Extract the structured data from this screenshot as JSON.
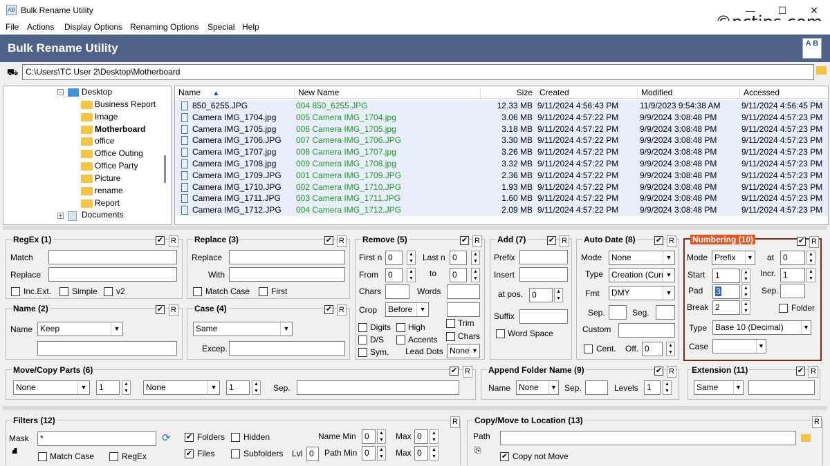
{
  "window": {
    "title": "Bulk Rename Utility",
    "minimize_glyph": "—",
    "maximize_glyph": "☐",
    "close_glyph": "✕"
  },
  "watermark": "©pctips.com",
  "menu": [
    "File",
    "Actions",
    "Display Options",
    "Renaming Options",
    "Special",
    "Help"
  ],
  "banner": {
    "title": "Bulk Rename Utility",
    "logo_text": "A B"
  },
  "path": "C:\\Users\\TC User 2\\Desktop\\Motherboard",
  "tree": {
    "items": [
      {
        "label": "Desktop",
        "bold": false,
        "icon": "desktop-icon"
      },
      {
        "label": "Business Report",
        "bold": false
      },
      {
        "label": "Image",
        "bold": false
      },
      {
        "label": "Motherboard",
        "bold": true
      },
      {
        "label": "office",
        "bold": false
      },
      {
        "label": "Office Outing",
        "bold": false
      },
      {
        "label": "Office Party",
        "bold": false
      },
      {
        "label": "Picture",
        "bold": false
      },
      {
        "label": "rename",
        "bold": false
      },
      {
        "label": "Report",
        "bold": false
      },
      {
        "label": "Documents",
        "bold": false,
        "icon": "documents-icon"
      }
    ]
  },
  "file_list": {
    "columns": [
      "Name",
      "New Name",
      "Size",
      "Created",
      "Modified",
      "Accessed"
    ],
    "sort_indicator": "▲",
    "rows": [
      {
        "name": "850_6255.JPG",
        "new": "004 850_6255.JPG",
        "size": "12.33 MB",
        "created": "9/11/2024 4:56:43 PM",
        "modified": "11/9/2023 9:54:38 AM",
        "accessed": "9/11/2024 4:56:45 PM"
      },
      {
        "name": "Camera IMG_1704.jpg",
        "new": "005 Camera IMG_1704.jpg",
        "size": "3.06 MB",
        "created": "9/11/2024 4:57:22 PM",
        "modified": "9/9/2024 3:08:48 PM",
        "accessed": "9/11/2024 4:57:23 PM"
      },
      {
        "name": "Camera IMG_1705.jpg",
        "new": "006 Camera IMG_1705.jpg",
        "size": "3.18 MB",
        "created": "9/11/2024 4:57:22 PM",
        "modified": "9/9/2024 3:08:48 PM",
        "accessed": "9/11/2024 4:57:23 PM"
      },
      {
        "name": "Camera IMG_1706.JPG",
        "new": "007 Camera IMG_1706.JPG",
        "size": "3.30 MB",
        "created": "9/11/2024 4:57:22 PM",
        "modified": "9/9/2024 3:08:48 PM",
        "accessed": "9/11/2024 4:57:23 PM"
      },
      {
        "name": "Camera IMG_1707.jpg",
        "new": "008 Camera IMG_1707.jpg",
        "size": "3.26 MB",
        "created": "9/11/2024 4:57:22 PM",
        "modified": "9/9/2024 3:08:48 PM",
        "accessed": "9/11/2024 4:57:23 PM"
      },
      {
        "name": "Camera IMG_1708.jpg",
        "new": "009 Camera IMG_1708.jpg",
        "size": "3.32 MB",
        "created": "9/11/2024 4:57:22 PM",
        "modified": "9/9/2024 3:08:48 PM",
        "accessed": "9/11/2024 4:57:23 PM"
      },
      {
        "name": "Camera IMG_1709.JPG",
        "new": "001 Camera IMG_1709.JPG",
        "size": "2.36 MB",
        "created": "9/11/2024 4:57:22 PM",
        "modified": "9/9/2024 3:08:48 PM",
        "accessed": "9/11/2024 4:57:23 PM"
      },
      {
        "name": "Camera IMG_1710.JPG",
        "new": "002 Camera IMG_1710.JPG",
        "size": "1.93 MB",
        "created": "9/11/2024 4:57:22 PM",
        "modified": "9/9/2024 3:08:48 PM",
        "accessed": "9/11/2024 4:57:23 PM"
      },
      {
        "name": "Camera IMG_1711.JPG",
        "new": "003 Camera IMG_1711.JPG",
        "size": "1.60 MB",
        "created": "9/11/2024 4:57:22 PM",
        "modified": "9/9/2024 3:08:48 PM",
        "accessed": "9/11/2024 4:57:23 PM"
      },
      {
        "name": "Camera IMG_1712.JPG",
        "new": "004 Camera IMG_1712.JPG",
        "size": "2.09 MB",
        "created": "9/11/2024 4:57:22 PM",
        "modified": "9/9/2024 3:08:48 PM",
        "accessed": "9/11/2024 4:57:23 PM"
      }
    ]
  },
  "checkmark": "✔",
  "regex": {
    "title": "RegEx (1)",
    "match": "Match",
    "replace": "Replace",
    "incext": "Inc.Ext.",
    "simple": "Simple",
    "v2": "v2",
    "r": "R"
  },
  "replace": {
    "title": "Replace (3)",
    "replace": "Replace",
    "with": "With",
    "match_case": "Match Case",
    "first": "First",
    "r": "R"
  },
  "remove": {
    "title": "Remove (5)",
    "first_n": "First n",
    "first_n_val": "0",
    "last_n": "Last n",
    "last_n_val": "0",
    "from": "From",
    "from_val": "0",
    "to": "to",
    "to_val": "0",
    "chars": "Chars",
    "words": "Words",
    "crop": "Crop",
    "crop_val": "Before",
    "digits": "Digits",
    "high": "High",
    "trim": "Trim",
    "ds": "D/S",
    "accents": "Accents",
    "chars2": "Chars",
    "sym": "Sym.",
    "lead_dots": "Lead Dots",
    "lead_dots_val": "None",
    "r": "R"
  },
  "add": {
    "title": "Add (7)",
    "prefix": "Prefix",
    "insert": "Insert",
    "at_pos": "at pos.",
    "at_pos_val": "0",
    "suffix": "Suffix",
    "word_space": "Word Space",
    "r": "R"
  },
  "autodate": {
    "title": "Auto Date (8)",
    "mode": "Mode",
    "mode_val": "None",
    "type": "Type",
    "type_val": "Creation (Curr",
    "fmt": "Fmt",
    "fmt_val": "DMY",
    "sep": "Sep.",
    "seg": "Seg.",
    "custom": "Custom",
    "cent": "Cent.",
    "off": "Off.",
    "off_val": "0",
    "r": "R"
  },
  "numbering": {
    "title": "Numbering (10)",
    "mode": "Mode",
    "mode_val": "Prefix",
    "at": "at",
    "at_val": "0",
    "start": "Start",
    "start_val": "1",
    "incr": "Incr.",
    "incr_val": "1",
    "pad": "Pad",
    "pad_val": "3",
    "sep": "Sep.",
    "brk": "Break",
    "break_val": "2",
    "folder": "Folder",
    "type": "Type",
    "type_val": "Base 10 (Decimal)",
    "case": "Case",
    "r": "R"
  },
  "name": {
    "title": "Name (2)",
    "name": "Name",
    "name_val": "Keep",
    "r": "R"
  },
  "case": {
    "title": "Case (4)",
    "case_val": "Same",
    "excep": "Excep.",
    "r": "R"
  },
  "movecopy": {
    "title": "Move/Copy Parts (6)",
    "sel1": "None",
    "num1": "1",
    "sel2": "None",
    "num2": "1",
    "sep": "Sep.",
    "r": "R"
  },
  "appendfolder": {
    "title": "Append Folder Name (9)",
    "name": "Name",
    "name_val": "None",
    "sep": "Sep.",
    "levels": "Levels",
    "levels_val": "1",
    "r": "R"
  },
  "extension": {
    "title": "Extension (11)",
    "val": "Same",
    "r": "R"
  },
  "filters": {
    "title": "Filters (12)",
    "mask": "Mask",
    "mask_val": "*",
    "folders": "Folders",
    "hidden": "Hidden",
    "files": "Files",
    "subfolders": "Subfolders",
    "lvl": "Lvl",
    "lvl_val": "0",
    "name_min": "Name Min",
    "name_min_val": "0",
    "max": "Max",
    "max_val": "0",
    "path_min": "Path Min",
    "path_min_val": "0",
    "max2_val": "0",
    "match_case": "Match Case",
    "regex": "RegEx",
    "r": "R"
  },
  "copymove": {
    "title": "Copy/Move to Location (13)",
    "path": "Path",
    "copy_not_move": "Copy not Move",
    "r": "R"
  }
}
